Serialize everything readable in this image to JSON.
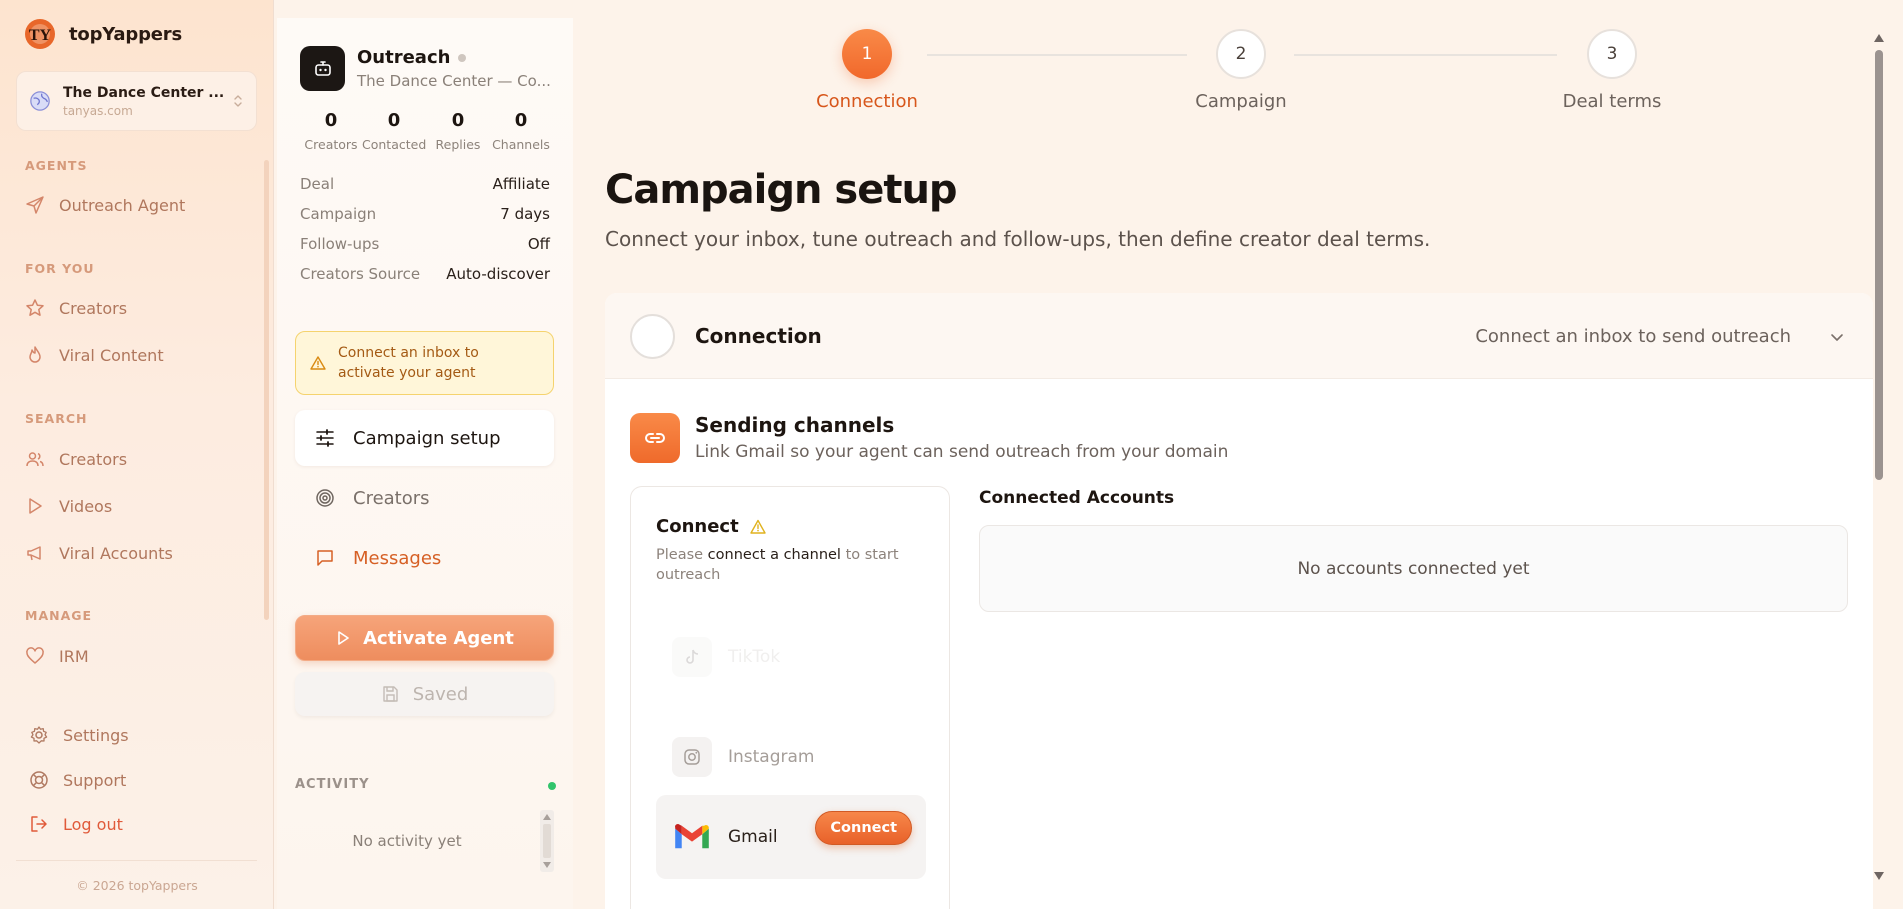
{
  "brand": {
    "name": "topYappers",
    "logo_text": "TY"
  },
  "workspace": {
    "name": "The Dance Center ...",
    "domain": "tanyas.com"
  },
  "nav": {
    "agents_title": "AGENTS",
    "outreach_agent": "Outreach Agent",
    "for_you_title": "FOR YOU",
    "creators": "Creators",
    "viral_content": "Viral Content",
    "search_title": "SEARCH",
    "search_creators": "Creators",
    "videos": "Videos",
    "viral_accounts": "Viral Accounts",
    "manage_title": "MANAGE",
    "irm": "IRM",
    "settings": "Settings",
    "support": "Support",
    "logout": "Log out",
    "copyright": "© 2026 topYappers"
  },
  "agent": {
    "title": "Outreach",
    "subtitle": "The Dance Center — Co...",
    "stats": [
      {
        "value": "0",
        "label": "Creators"
      },
      {
        "value": "0",
        "label": "Contacted"
      },
      {
        "value": "0",
        "label": "Replies"
      },
      {
        "value": "0",
        "label": "Channels"
      }
    ],
    "details": [
      {
        "key": "Deal",
        "value": "Affiliate"
      },
      {
        "key": "Campaign",
        "value": "7 days"
      },
      {
        "key": "Follow-ups",
        "value": "Off"
      },
      {
        "key": "Creators Source",
        "value": "Auto-discover"
      }
    ],
    "alert": "Connect an inbox to activate your agent",
    "menu": {
      "campaign_setup": "Campaign setup",
      "creators": "Creators",
      "messages": "Messages"
    },
    "activate_label": "Activate Agent",
    "saved_label": "Saved",
    "activity_title": "ACTIVITY",
    "activity_empty": "No activity yet"
  },
  "steps": [
    {
      "number": "1",
      "label": "Connection"
    },
    {
      "number": "2",
      "label": "Campaign"
    },
    {
      "number": "3",
      "label": "Deal terms"
    }
  ],
  "page": {
    "title": "Campaign setup",
    "subtitle": "Connect your inbox, tune outreach and follow-ups, then define creator deal terms."
  },
  "connection": {
    "title": "Connection",
    "status": "Connect an inbox to send outreach"
  },
  "sending": {
    "title": "Sending channels",
    "subtitle": "Link Gmail so your agent can send outreach from your domain",
    "connect_title": "Connect",
    "connect_sub_prefix": "Please",
    "connect_sub_link": "connect a channel",
    "connect_sub_suffix": "to start outreach",
    "channels": {
      "tiktok": "TikTok",
      "instagram": "Instagram",
      "gmail": "Gmail"
    },
    "gmail_button": "Connect",
    "accounts_title": "Connected Accounts",
    "accounts_empty": "No accounts connected yet"
  },
  "colors": {
    "accent": "#f26f31",
    "accent_text": "#d7561b",
    "nav_text": "#b0775d",
    "alert_bg": "#fff6d9",
    "alert_border": "#f5d36e",
    "activity_dot": "#31c46b"
  }
}
